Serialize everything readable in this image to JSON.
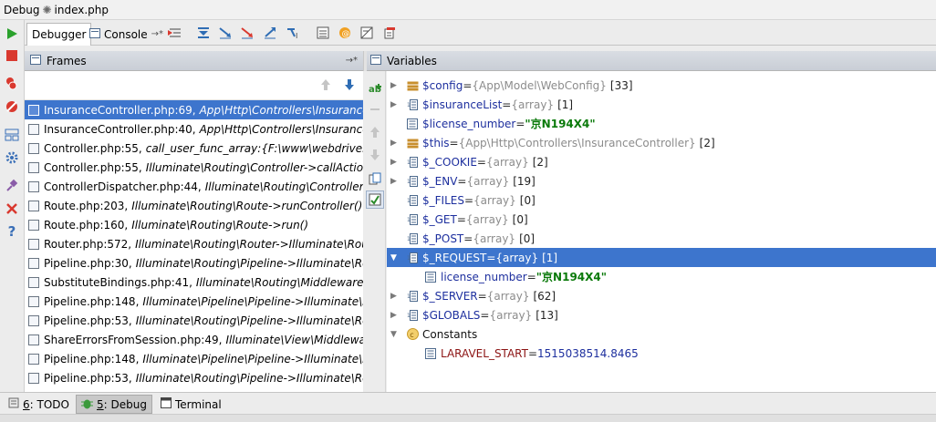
{
  "window": {
    "title_prefix": "Debug",
    "title_file": "index.php"
  },
  "tabs": [
    {
      "label": "Debugger",
      "active": true
    },
    {
      "label": "Console",
      "active": false,
      "pin": "→*"
    }
  ],
  "frames": {
    "title": "Frames",
    "pin": "→*",
    "rows": [
      {
        "location": "InsuranceController.php:69,",
        "func": "App\\Http\\Controllers\\InsuranceController",
        "selected": true
      },
      {
        "location": "InsuranceController.php:40,",
        "func": "App\\Http\\Controllers\\InsuranceController"
      },
      {
        "location": "Controller.php:55,",
        "func": "call_user_func_array:{F:\\www\\webdriver\\vendor"
      },
      {
        "location": "Controller.php:55,",
        "func": "Illuminate\\Routing\\Controller->callAction()"
      },
      {
        "location": "ControllerDispatcher.php:44,",
        "func": "Illuminate\\Routing\\ControllerDispatcher"
      },
      {
        "location": "Route.php:203,",
        "func": "Illuminate\\Routing\\Route->runController()"
      },
      {
        "location": "Route.php:160,",
        "func": "Illuminate\\Routing\\Route->run()"
      },
      {
        "location": "Router.php:572,",
        "func": "Illuminate\\Routing\\Router->Illuminate\\Routing"
      },
      {
        "location": "Pipeline.php:30,",
        "func": "Illuminate\\Routing\\Pipeline->Illuminate\\Routing"
      },
      {
        "location": "SubstituteBindings.php:41,",
        "func": "Illuminate\\Routing\\Middleware\\SubstituteBindings"
      },
      {
        "location": "Pipeline.php:148,",
        "func": "Illuminate\\Pipeline\\Pipeline->Illuminate\\Pipeline"
      },
      {
        "location": "Pipeline.php:53,",
        "func": "Illuminate\\Routing\\Pipeline->Illuminate\\Routing"
      },
      {
        "location": "ShareErrorsFromSession.php:49,",
        "func": "Illuminate\\View\\Middleware\\ShareErrors"
      },
      {
        "location": "Pipeline.php:148,",
        "func": "Illuminate\\Pipeline\\Pipeline->Illuminate\\Pipeline"
      },
      {
        "location": "Pipeline.php:53,",
        "func": "Illuminate\\Routing\\Pipeline->Illuminate\\Routing"
      }
    ]
  },
  "variables": {
    "title": "Variables",
    "rows": [
      {
        "arrow": "▶",
        "icon": "object",
        "name": "$config",
        "eq": " = ",
        "type": "{App\\Model\\WebConfig}",
        "count": "[33]"
      },
      {
        "arrow": "▶",
        "icon": "array",
        "name": "$insuranceList",
        "eq": " = ",
        "type": "{array}",
        "count": "[1]"
      },
      {
        "arrow": "",
        "icon": "scalar",
        "name": "$license_number",
        "eq": " = ",
        "str": "\"京N194X4\""
      },
      {
        "arrow": "▶",
        "icon": "object",
        "name": "$this",
        "eq": " = ",
        "type": "{App\\Http\\Controllers\\InsuranceController}",
        "count": "[2]"
      },
      {
        "arrow": "▶",
        "icon": "array",
        "name": "$_COOKIE",
        "eq": " = ",
        "type": "{array}",
        "count": "[2]"
      },
      {
        "arrow": "▶",
        "icon": "array",
        "name": "$_ENV",
        "eq": " = ",
        "type": "{array}",
        "count": "[19]"
      },
      {
        "arrow": "",
        "icon": "array",
        "name": "$_FILES",
        "eq": " = ",
        "type": "{array}",
        "count": "[0]"
      },
      {
        "arrow": "",
        "icon": "array",
        "name": "$_GET",
        "eq": " = ",
        "type": "{array}",
        "count": "[0]"
      },
      {
        "arrow": "",
        "icon": "array",
        "name": "$_POST",
        "eq": " = ",
        "type": "{array}",
        "count": "[0]"
      },
      {
        "arrow": "▼",
        "icon": "array",
        "name": "$_REQUEST",
        "eq": " = ",
        "type": "{array}",
        "count": "[1]",
        "selected": true
      },
      {
        "arrow": "",
        "icon": "scalar",
        "indent": true,
        "name": "license_number",
        "eq": " = ",
        "str": "\"京N194X4\""
      },
      {
        "arrow": "▶",
        "icon": "array",
        "name": "$_SERVER",
        "eq": " = ",
        "type": "{array}",
        "count": "[62]"
      },
      {
        "arrow": "▶",
        "icon": "array",
        "name": "$GLOBALS",
        "eq": " = ",
        "type": "{array}",
        "count": "[13]"
      },
      {
        "arrow": "▼",
        "icon": "constants",
        "plain": "Constants"
      },
      {
        "arrow": "",
        "icon": "scalar",
        "indent": true,
        "constkey": "LARAVEL_START",
        "eq": " = ",
        "num": "1515038514.8465"
      }
    ]
  },
  "bottom": {
    "tabs": [
      {
        "num": "6",
        "label": ": TODO"
      },
      {
        "num": "5",
        "label": ": Debug",
        "active": true
      },
      {
        "num": "",
        "label": "Terminal"
      }
    ]
  },
  "colors": {
    "selection": "#3d75cd",
    "var_name": "#1d2f9e",
    "string_value": "#0a7a0a",
    "constant_key": "#8c1414"
  }
}
